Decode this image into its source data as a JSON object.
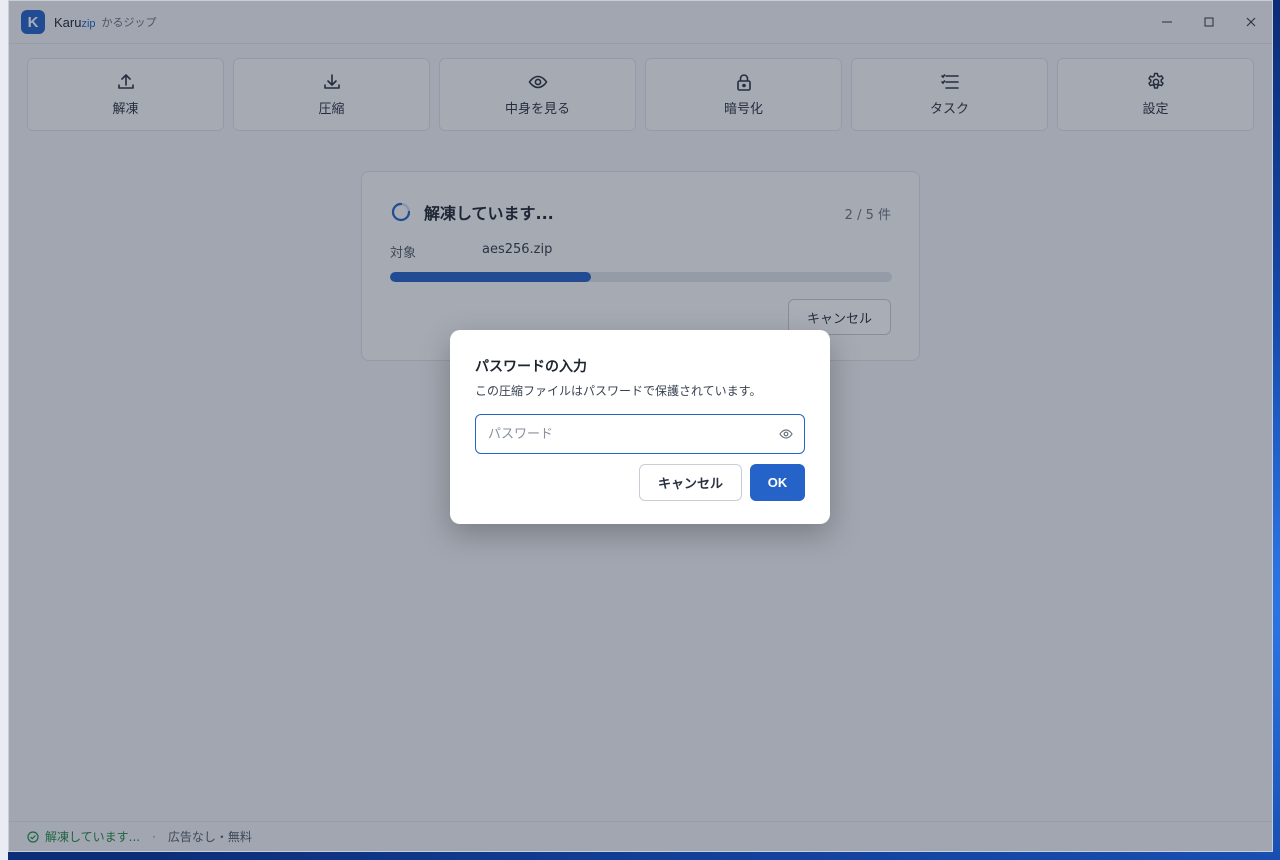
{
  "app": {
    "logo_letter": "K",
    "name": "Karu",
    "name_suffix": "zip",
    "subtitle": "かるジップ"
  },
  "window_controls": {
    "minimize": "–",
    "maximize": "□",
    "close": "✕"
  },
  "toolbar": [
    {
      "label": "解凍",
      "icon": "upload-icon"
    },
    {
      "label": "圧縮",
      "icon": "download-icon"
    },
    {
      "label": "中身を見る",
      "icon": "eye-icon"
    },
    {
      "label": "暗号化",
      "icon": "lock-icon"
    },
    {
      "label": "タスク",
      "icon": "list-icon"
    },
    {
      "label": "設定",
      "icon": "gear-icon"
    }
  ],
  "progress": {
    "title": "解凍しています...",
    "count": "2 / 5 件",
    "target_label": "対象",
    "target_value": "aes256.zip",
    "fraction": 0.4,
    "cancel_label": "キャンセル"
  },
  "dialog": {
    "title": "パスワードの入力",
    "message": "この圧縮ファイルはパスワードで保護されています。",
    "input_placeholder": "パスワード",
    "input_value": "",
    "cancel_label": "キャンセル",
    "ok_label": "OK"
  },
  "status": {
    "state": "解凍しています...",
    "separator": "·",
    "note": "広告なし・無料"
  },
  "colors": {
    "accent": "#2563c9",
    "status_ok": "#1f8a45"
  }
}
